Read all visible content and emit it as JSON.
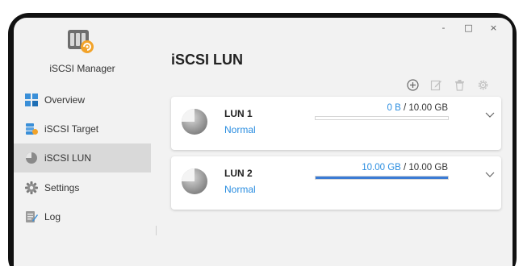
{
  "window": {
    "controls": {
      "minimize": "-",
      "maximize": "□",
      "close": "×"
    }
  },
  "sidebar": {
    "app_name": "iSCSI Manager",
    "items": [
      {
        "label": "Overview",
        "icon": "overview-icon",
        "active": false
      },
      {
        "label": "iSCSI Target",
        "icon": "target-icon",
        "active": false
      },
      {
        "label": "iSCSI LUN",
        "icon": "lun-icon",
        "active": true
      },
      {
        "label": "Settings",
        "icon": "gear-icon",
        "active": false
      },
      {
        "label": "Log",
        "icon": "log-icon",
        "active": false
      }
    ]
  },
  "main": {
    "title": "iSCSI LUN",
    "toolbar": [
      "add-icon",
      "edit-icon",
      "delete-icon",
      "settings-icon"
    ],
    "luns": [
      {
        "name": "LUN 1",
        "status": "Normal",
        "used": "0 B",
        "separator": " / ",
        "total": "10.00 GB",
        "usage_fraction": 0.0
      },
      {
        "name": "LUN 2",
        "status": "Normal",
        "used": "10.00 GB",
        "separator": " / ",
        "total": "10.00 GB",
        "usage_fraction": 1.0
      }
    ]
  },
  "colors": {
    "accent": "#2a8de0",
    "bar_fill": "#3a7bd5",
    "active_nav": "#d9d9d9"
  }
}
